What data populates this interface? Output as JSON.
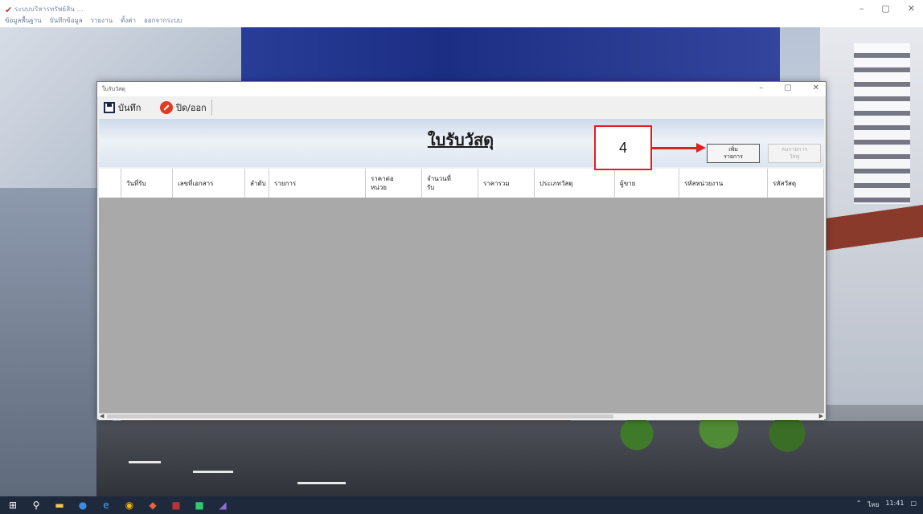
{
  "app": {
    "title": "ระบบบริหารทรัพย์สิน ...",
    "menu": [
      "ข้อมูลพื้นฐาน",
      "บันทึกข้อมูล",
      "รายงาน",
      "ตั้งค่า",
      "ออกจากระบบ"
    ],
    "window_controls": [
      "–",
      "▢",
      "✕"
    ]
  },
  "dialog": {
    "title": "ใบรับวัสดุ",
    "window_controls": [
      "–",
      "▢",
      "✕"
    ],
    "toolbar": {
      "save_label": "บันทึก",
      "close_label": "ปิด/ออก"
    },
    "form_title": "ใบรับวัสดุ",
    "add_button": "เพิ่ม\nรายการ",
    "delete_button": "ลบรายการ\nวัสดุ",
    "columns": [
      "",
      "วันที่รับ",
      "เลขที่เอกสาร",
      "ลำดับ",
      "รายการ",
      "ราคาต่อ\nหน่วย",
      "จำนวนที่\nรับ",
      "ราคารวม",
      "ประเภทวัสดุ",
      "ผู้ขาย",
      "รหัสหน่วยงาน",
      "รหัสวัสดุ"
    ]
  },
  "callout": {
    "label": "4"
  },
  "taskbar": {
    "icons": [
      "windows-start-icon",
      "search-icon",
      "file-explorer-icon",
      "edge-icon",
      "ie-icon",
      "chrome-icon",
      "app-icon",
      "access-icon",
      "line-icon",
      "visual-studio-icon"
    ],
    "tray_text": "ไทย",
    "time": "11:41"
  }
}
